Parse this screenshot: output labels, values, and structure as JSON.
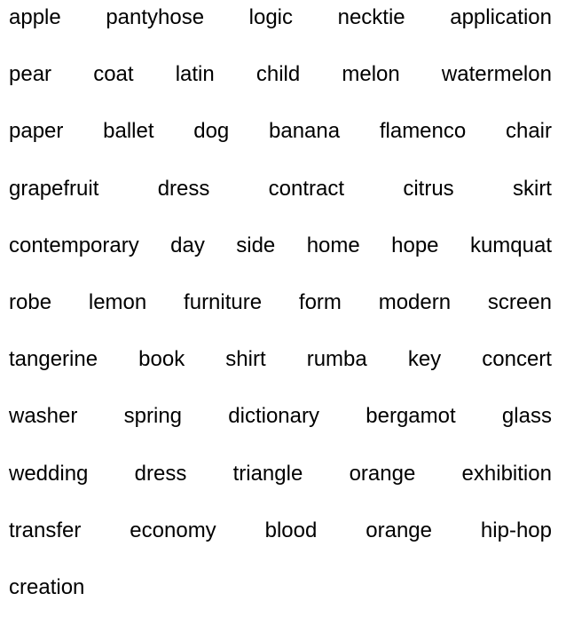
{
  "rows": [
    [
      "apple",
      "pantyhose",
      "logic",
      "necktie",
      "application"
    ],
    [
      "pear",
      "coat",
      "latin",
      "child",
      "melon",
      "watermelon"
    ],
    [
      "paper",
      "ballet",
      "dog",
      "banana",
      "flamenco",
      "chair"
    ],
    [
      "grapefruit",
      "dress",
      "contract",
      "citrus",
      "skirt"
    ],
    [
      "contemporary",
      "day",
      "side",
      "home",
      "hope",
      "kumquat"
    ],
    [
      "robe",
      "lemon",
      "furniture",
      "form",
      "modern",
      "screen"
    ],
    [
      "tangerine",
      "book",
      "shirt",
      "rumba",
      "key",
      "concert"
    ],
    [
      "washer",
      "spring",
      "dictionary",
      "bergamot",
      "glass"
    ],
    [
      "wedding",
      "dress",
      "triangle",
      "orange",
      "exhibition"
    ],
    [
      "transfer",
      "economy",
      "blood",
      "orange",
      "hip-hop"
    ],
    [
      "creation"
    ]
  ]
}
